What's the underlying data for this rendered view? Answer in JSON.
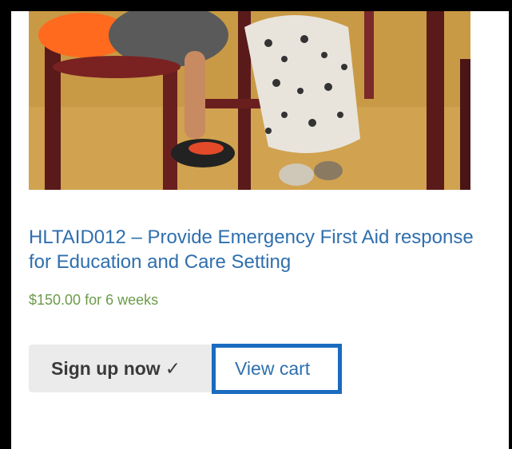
{
  "product": {
    "title": "HLTAID012 – Provide Emergency First Aid response for Education and Care Setting",
    "price": "$150.00 for 6 weeks",
    "image_subject": "children sitting on chairs in a classroom"
  },
  "actions": {
    "signup_label": "Sign up now",
    "signup_check": "✓",
    "view_cart_label": "View cart"
  },
  "colors": {
    "title": "#2f6fad",
    "price": "#6c9b4a",
    "button_bg": "#ebebeb",
    "highlight_border": "#1a6bc0"
  }
}
